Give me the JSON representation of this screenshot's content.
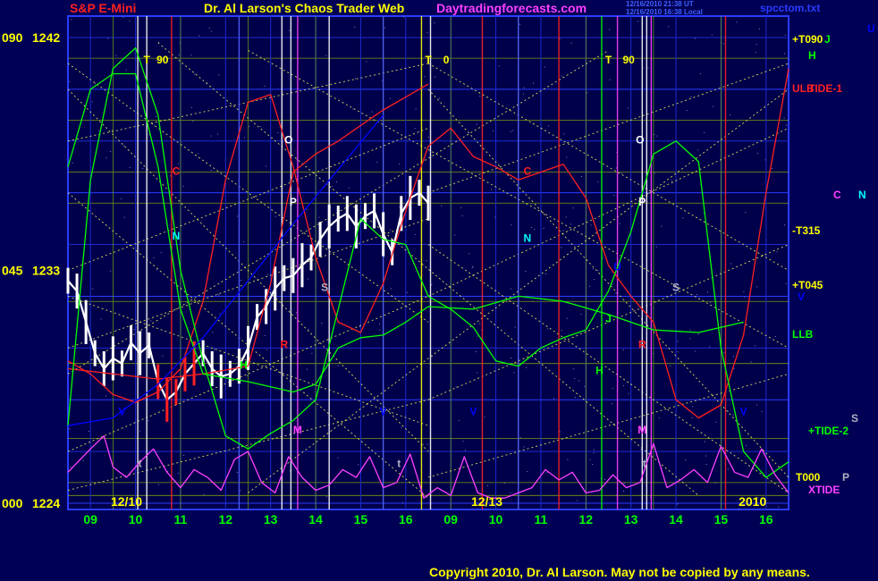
{
  "header": {
    "symbol": "S&P E-Mini",
    "title": "Dr. Al Larson's Chaos Trader Web",
    "site": "Daytradingforecasts.com",
    "stamp_ut": "12/16/2010 21:38 UT",
    "stamp_local": "12/16/2010 16:38 Local",
    "file": "spcctom.txt"
  },
  "footer": {
    "copyright": "Copyright 2010, Dr. Al Larson. May not be copied by any means."
  },
  "colors": {
    "background": "#000055",
    "frame": "#2a3cff",
    "yellow": "#ffff00",
    "green": "#00ff00",
    "red": "#ff2020",
    "magenta": "#ff40ff",
    "cyan": "#00ffff",
    "blue": "#0000ff"
  },
  "chart_data": {
    "type": "line",
    "title": "S&P E-Mini",
    "ylim": [
      1224,
      1242
    ],
    "y_tick_labels": [
      {
        "angle": "090",
        "price": "1242",
        "value": 1242
      },
      {
        "angle": "045",
        "price": "1233",
        "value": 1233
      },
      {
        "angle": "000",
        "price": "1224",
        "value": 1224
      }
    ],
    "x_tick_labels": [
      "09",
      "10",
      "11",
      "12",
      "13",
      "14",
      "15",
      "16",
      "09",
      "10",
      "11",
      "12",
      "13",
      "14",
      "15",
      "16"
    ],
    "date_labels": [
      "12/10",
      "12/13",
      "2010"
    ],
    "right_labels": [
      {
        "text": "+T090",
        "color": "yellow"
      },
      {
        "text": "J",
        "color": "green"
      },
      {
        "text": "H",
        "color": "green"
      },
      {
        "text": "ULB",
        "color": "red"
      },
      {
        "text": "TIDE-1",
        "color": "red"
      },
      {
        "text": "-T315",
        "color": "yellow"
      },
      {
        "text": "+T045",
        "color": "yellow"
      },
      {
        "text": "V",
        "color": "blue"
      },
      {
        "text": "LLB",
        "color": "green"
      },
      {
        "text": "+TIDE-2",
        "color": "green"
      },
      {
        "text": "T000",
        "color": "yellow"
      },
      {
        "text": "XTIDE",
        "color": "magenta"
      },
      {
        "text": "U",
        "color": "blue"
      },
      {
        "text": "C",
        "color": "magenta"
      },
      {
        "text": "N",
        "color": "cyan"
      },
      {
        "text": "S",
        "color": "gray"
      },
      {
        "text": "P",
        "color": "gray"
      }
    ],
    "markers": [
      {
        "text": "T",
        "x": 9.75,
        "y": 1241,
        "color": "yellow"
      },
      {
        "text": "90",
        "x": 10.1,
        "y": 1241,
        "color": "yellow"
      },
      {
        "text": "T",
        "x": 16.0,
        "y": 1241,
        "color": "yellow"
      },
      {
        "text": "0",
        "x": 16.4,
        "y": 1241,
        "color": "yellow"
      },
      {
        "text": "T",
        "x": 12.0,
        "y": 1241,
        "color": "yellow",
        "day": 2
      },
      {
        "text": "90",
        "x": 12.45,
        "y": 1241,
        "color": "yellow",
        "day": 2
      },
      {
        "text": "C",
        "x": 10.4,
        "y": 1236.7,
        "color": "red"
      },
      {
        "text": "N",
        "x": 10.4,
        "y": 1234.2,
        "color": "cyan"
      },
      {
        "text": "O",
        "x": 12.9,
        "y": 1237.9,
        "color": "white"
      },
      {
        "text": "P",
        "x": 13.0,
        "y": 1235.5,
        "color": "white"
      },
      {
        "text": "S",
        "x": 13.7,
        "y": 1232.2,
        "color": "gray"
      },
      {
        "text": "R",
        "x": 12.8,
        "y": 1230.0,
        "color": "red"
      },
      {
        "text": "H",
        "x": 11.9,
        "y": 1229.2,
        "color": "green"
      },
      {
        "text": "V",
        "x": 9.2,
        "y": 1227.4,
        "color": "blue"
      },
      {
        "text": "M",
        "x": 13.1,
        "y": 1226.7,
        "color": "magenta"
      },
      {
        "text": "t",
        "x": 9.6,
        "y": 1225.4,
        "color": "gray"
      },
      {
        "text": "V",
        "x": 15.0,
        "y": 1227.4,
        "color": "blue"
      },
      {
        "text": "t",
        "x": 15.35,
        "y": 1225.4,
        "color": "gray"
      },
      {
        "text": "C",
        "x": 10.2,
        "y": 1236.7,
        "color": "red",
        "day": 2
      },
      {
        "text": "N",
        "x": 10.2,
        "y": 1234.1,
        "color": "cyan",
        "day": 2
      },
      {
        "text": "V",
        "x": 9.0,
        "y": 1227.4,
        "color": "blue",
        "day": 2
      },
      {
        "text": "O",
        "x": 12.7,
        "y": 1237.9,
        "color": "white",
        "day": 2
      },
      {
        "text": "P",
        "x": 12.75,
        "y": 1235.5,
        "color": "white",
        "day": 2
      },
      {
        "text": "S",
        "x": 13.5,
        "y": 1232.2,
        "color": "gray",
        "day": 2
      },
      {
        "text": "R",
        "x": 12.75,
        "y": 1230.0,
        "color": "red",
        "day": 2
      },
      {
        "text": "H",
        "x": 11.8,
        "y": 1229.0,
        "color": "green",
        "day": 2
      },
      {
        "text": "J",
        "x": 12.0,
        "y": 1231.0,
        "color": "green",
        "day": 2
      },
      {
        "text": "U",
        "x": 12.2,
        "y": 1233.0,
        "color": "blue",
        "day": 2
      },
      {
        "text": "M",
        "x": 12.75,
        "y": 1226.7,
        "color": "magenta",
        "day": 2
      },
      {
        "text": "t",
        "x": 12.8,
        "y": 1225.4,
        "color": "gray",
        "day": 2
      },
      {
        "text": "V",
        "x": 15.0,
        "y": 1227.4,
        "color": "blue",
        "day": 2
      }
    ],
    "series": [
      {
        "name": "price",
        "color": "white",
        "x": [
          8.0,
          8.2,
          8.4,
          8.6,
          8.8,
          9.0,
          9.2,
          9.4,
          9.6,
          9.8,
          10.0,
          10.2,
          10.4,
          10.6,
          10.8,
          11.0,
          11.2,
          11.4,
          11.6,
          11.8,
          12.0,
          12.2,
          12.4,
          12.6,
          12.8,
          13.0,
          13.2,
          13.4,
          13.6,
          13.8,
          14.0,
          14.2,
          14.4,
          14.6,
          14.8,
          15.0,
          15.2,
          15.4,
          15.6,
          15.8,
          16.0
        ],
        "y": [
          1232.6,
          1232.2,
          1231.0,
          1229.8,
          1229.2,
          1229.6,
          1229.4,
          1230.2,
          1229.8,
          1230.1,
          1228.7,
          1228.0,
          1228.3,
          1229.0,
          1229.4,
          1229.8,
          1229.2,
          1228.9,
          1229.0,
          1229.3,
          1230.0,
          1231.2,
          1231.6,
          1232.3,
          1232.7,
          1232.8,
          1233.2,
          1233.5,
          1234.2,
          1234.7,
          1235.0,
          1235.2,
          1234.7,
          1235.1,
          1235.3,
          1234.4,
          1233.7,
          1235.2,
          1235.8,
          1236.0,
          1235.6
        ]
      },
      {
        "name": "C",
        "color": "red",
        "x": [
          8.0,
          8.5,
          9.0,
          9.5,
          10.0,
          10.5,
          11.0,
          11.5,
          12.0,
          12.5,
          13.0,
          13.5,
          14.0,
          14.5,
          15.0,
          15.5,
          16.0,
          16.5,
          17.0,
          17.5,
          18.0,
          18.5,
          19.0,
          19.5,
          20.0,
          20.5,
          21.0,
          21.5,
          22.0,
          22.5,
          23.0,
          23.5,
          24.0
        ],
        "y": [
          1229.5,
          1229.0,
          1228.2,
          1227.9,
          1228.3,
          1229.2,
          1231.8,
          1236.5,
          1239.5,
          1239.8,
          1237.0,
          1233.5,
          1231.0,
          1230.6,
          1232.5,
          1235.3,
          1237.8,
          1238.5,
          1237.4,
          1237.0,
          1236.5,
          1236.8,
          1237.1,
          1235.8,
          1233.2,
          1232.0,
          1231.0,
          1228.0,
          1227.3,
          1227.8,
          1230.5,
          1236.0,
          1240.8
        ]
      },
      {
        "name": "ULB",
        "color": "red",
        "x": [
          8.0,
          9.0,
          10.0,
          11.0,
          12.0,
          12.5,
          13.0,
          13.5,
          14.0,
          14.5,
          15.0,
          15.5,
          16.0
        ],
        "y": [
          1229.2,
          1229.0,
          1228.8,
          1229.0,
          1229.3,
          1232.5,
          1236.8,
          1237.5,
          1238.0,
          1238.6,
          1239.2,
          1239.7,
          1240.2
        ]
      },
      {
        "name": "N",
        "color": "green",
        "x": [
          8.0,
          8.5,
          9.0,
          9.5,
          10.0,
          10.5,
          11.0,
          11.5,
          12.0,
          12.5,
          13.0,
          13.5,
          14.0,
          14.5,
          15.0,
          15.5,
          16.0,
          16.5,
          17.0,
          17.5,
          18.0,
          18.5,
          19.0,
          19.5,
          20.0,
          20.5,
          21.0,
          21.5,
          22.0,
          22.5,
          23.0,
          23.5,
          24.0
        ],
        "y": [
          1227.0,
          1236.5,
          1240.8,
          1241.6,
          1239.0,
          1233.0,
          1229.5,
          1226.6,
          1226.1,
          1226.7,
          1227.2,
          1228.0,
          1231.5,
          1235.0,
          1234.2,
          1234.0,
          1232.0,
          1231.5,
          1230.8,
          1229.5,
          1229.3,
          1230.0,
          1230.4,
          1230.7,
          1232.2,
          1234.5,
          1237.5,
          1238.0,
          1237.2,
          1230.0,
          1226.0,
          1225.0,
          1225.6
        ]
      },
      {
        "name": "LLB",
        "color": "green",
        "x": [
          8.0,
          8.5,
          9.0,
          9.5,
          10.0,
          10.5,
          11.0,
          12.0,
          13.0,
          13.5,
          14.0,
          14.5,
          15.0,
          15.5,
          16.0,
          17.0,
          18.0,
          19.0,
          20.0,
          21.0,
          22.0,
          23.0
        ],
        "y": [
          1237.0,
          1240.0,
          1240.6,
          1240.6,
          1237.0,
          1231.5,
          1229.0,
          1228.7,
          1228.3,
          1228.6,
          1230.0,
          1230.4,
          1230.5,
          1231.0,
          1231.6,
          1231.5,
          1232.0,
          1231.8,
          1231.3,
          1230.7,
          1230.6,
          1231.0
        ]
      },
      {
        "name": "TIDE-2",
        "color": "magenta",
        "x": [
          8.0,
          8.5,
          8.8,
          9.0,
          9.3,
          9.6,
          9.9,
          10.2,
          10.5,
          10.8,
          11.1,
          11.4,
          11.7,
          12.0,
          12.3,
          12.6,
          12.9,
          13.2,
          13.5,
          13.8,
          14.1,
          14.4,
          14.7,
          15.0,
          15.3,
          15.6,
          15.9,
          16.2,
          16.5,
          16.8,
          17.1,
          17.4,
          17.7,
          18.0,
          18.3,
          18.6,
          18.9,
          19.2,
          19.5,
          19.8,
          20.1,
          20.4,
          20.7,
          21.0,
          21.3,
          21.6,
          21.9,
          22.2,
          22.5,
          22.8,
          23.1,
          23.4,
          23.7,
          24.0
        ],
        "y": [
          1225.2,
          1226.1,
          1226.6,
          1225.4,
          1225.0,
          1225.6,
          1226.1,
          1225.2,
          1224.6,
          1225.3,
          1225.0,
          1224.5,
          1225.7,
          1226.0,
          1224.8,
          1224.4,
          1225.8,
          1225.0,
          1224.5,
          1224.7,
          1225.3,
          1225.0,
          1225.8,
          1224.6,
          1224.8,
          1225.9,
          1224.2,
          1224.6,
          1224.3,
          1225.8,
          1224.4,
          1224.2,
          1224.2,
          1224.4,
          1224.6,
          1225.3,
          1224.9,
          1225.2,
          1224.4,
          1224.5,
          1225.1,
          1224.6,
          1224.8,
          1226.3,
          1224.6,
          1224.9,
          1225.3,
          1224.8,
          1226.2,
          1225.2,
          1225.0,
          1226.1,
          1225.1,
          1224.4
        ]
      },
      {
        "name": "V",
        "color": "blue",
        "x": [
          8.0,
          9.0,
          10.0,
          11.0,
          12.0,
          13.0,
          14.0,
          15.0
        ],
        "y": [
          1227.0,
          1227.3,
          1228.6,
          1230.4,
          1232.6,
          1234.8,
          1236.9,
          1239.0
        ]
      }
    ]
  }
}
